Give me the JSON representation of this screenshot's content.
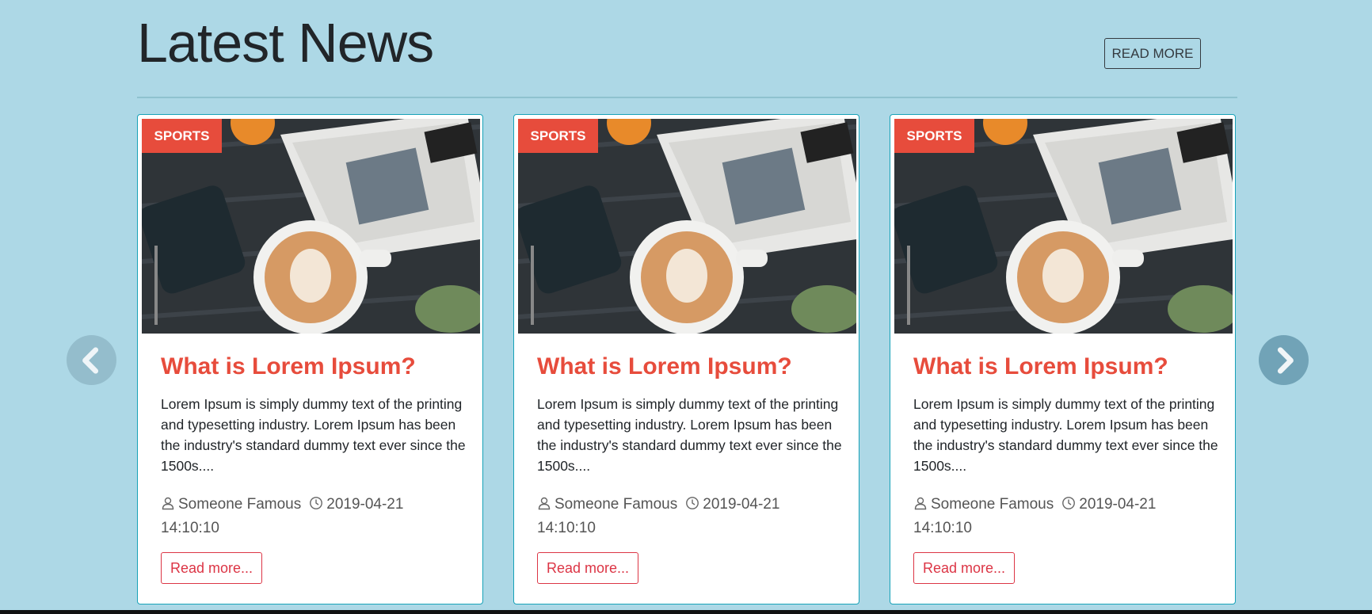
{
  "header": {
    "title": "Latest News",
    "read_more_label": "READ MORE"
  },
  "carousel": {
    "prev_icon": "chevron-left-icon",
    "next_icon": "chevron-right-icon"
  },
  "cards": [
    {
      "category": "SPORTS",
      "image": "coffee-and-newspaper-photo",
      "title": "What is Lorem Ipsum?",
      "text": "Lorem Ipsum is simply dummy text of the printing and typesetting industry. Lorem Ipsum has been the industry's standard dummy text ever since the 1500s....",
      "author": "Someone Famous",
      "date": "2019-04-21",
      "time": "14:10:10",
      "read_more": "Read more..."
    },
    {
      "category": "SPORTS",
      "image": "coffee-and-newspaper-photo",
      "title": "What is Lorem Ipsum?",
      "text": "Lorem Ipsum is simply dummy text of the printing and typesetting industry. Lorem Ipsum has been the industry's standard dummy text ever since the 1500s....",
      "author": "Someone Famous",
      "date": "2019-04-21",
      "time": "14:10:10",
      "read_more": "Read more..."
    },
    {
      "category": "SPORTS",
      "image": "coffee-and-newspaper-photo",
      "title": "What is Lorem Ipsum?",
      "text": "Lorem Ipsum is simply dummy text of the printing and typesetting industry. Lorem Ipsum has been the industry's standard dummy text ever since the 1500s....",
      "author": "Someone Famous",
      "date": "2019-04-21",
      "time": "14:10:10",
      "read_more": "Read more..."
    }
  ],
  "colors": {
    "background": "#add8e6",
    "accent": "#e74c3c",
    "button_red": "#dc3545",
    "card_border": "#17a2b8"
  }
}
